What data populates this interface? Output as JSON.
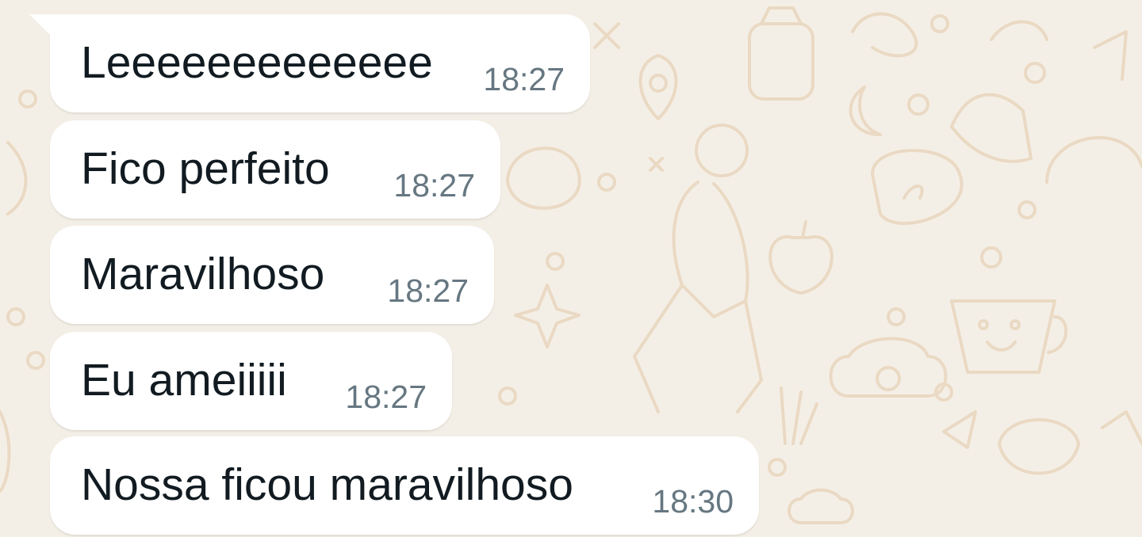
{
  "conversation": {
    "messages": [
      {
        "text": "Leeeeeeeeeeeee",
        "time": "18:27"
      },
      {
        "text": "Fico perfeito",
        "time": "18:27"
      },
      {
        "text": "Maravilhoso",
        "time": "18:27"
      },
      {
        "text": "Eu ameiiiii",
        "time": "18:27"
      },
      {
        "text": "Nossa ficou maravilhoso",
        "time": "18:30"
      }
    ]
  },
  "colors": {
    "wallpaper": "#f4efe6",
    "doodle": "#ead9c3",
    "bubble": "#ffffff",
    "message_text": "#111b21",
    "timestamp": "#667781"
  },
  "icons": [
    "wallpaper-doodle-pattern"
  ]
}
